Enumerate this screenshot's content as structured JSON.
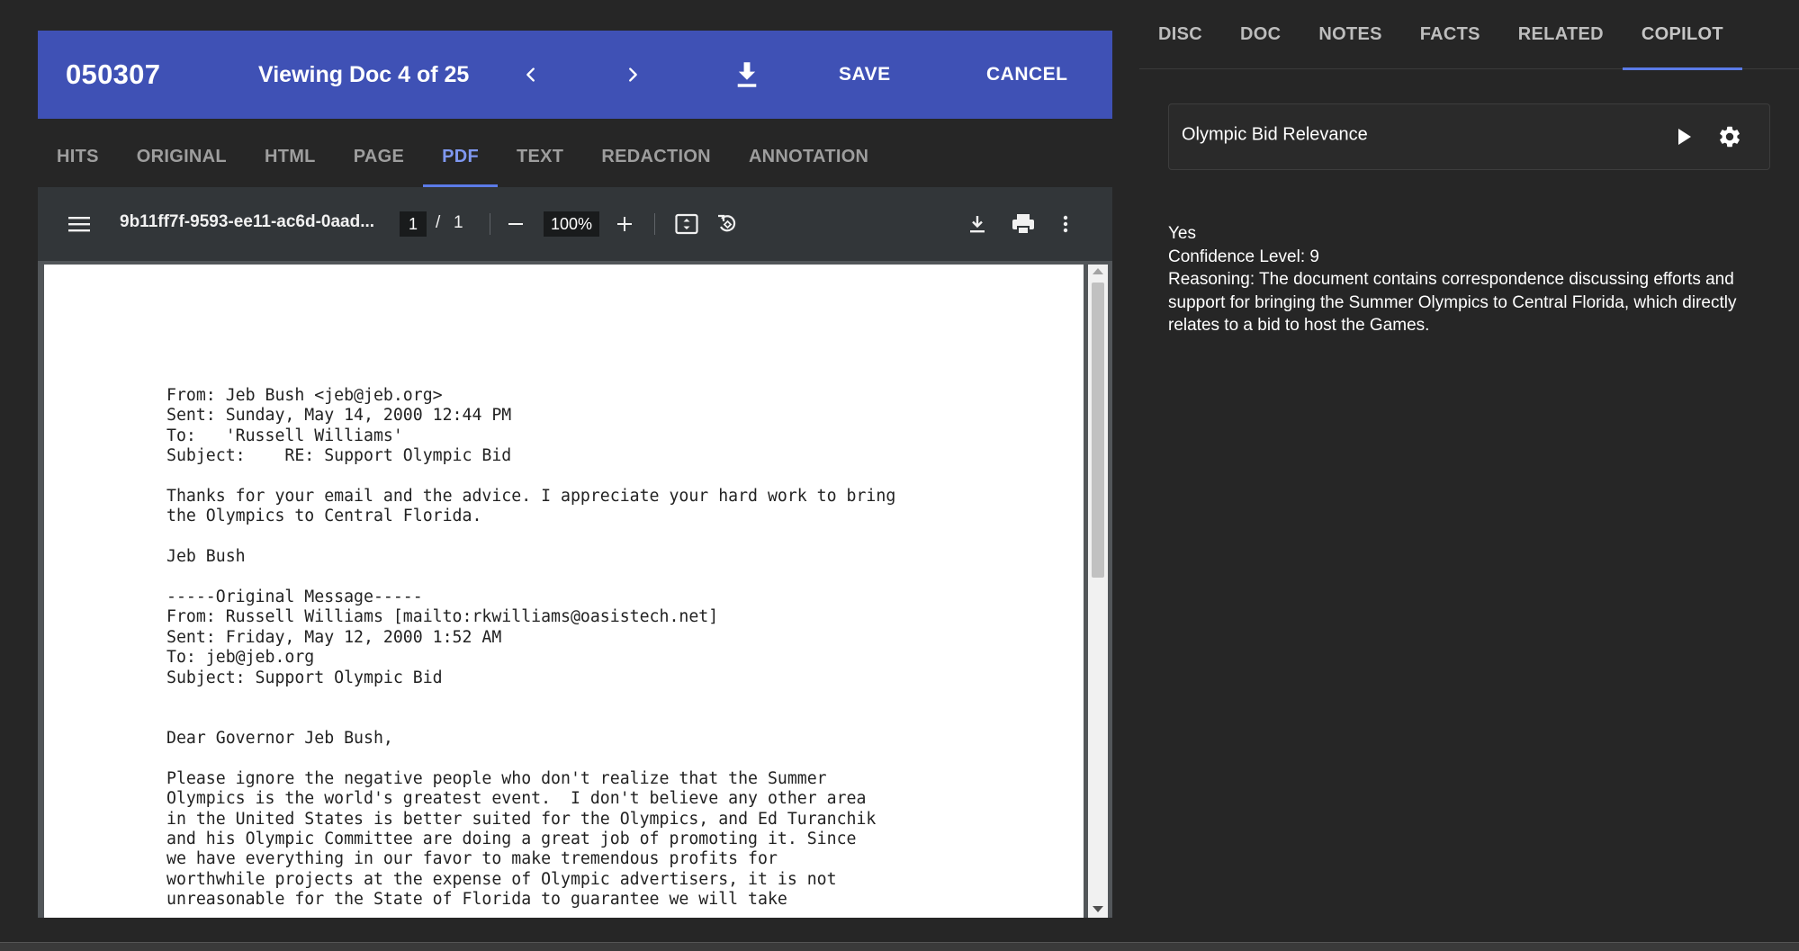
{
  "header": {
    "doc_id": "050307",
    "viewing": "Viewing Doc 4 of 25",
    "save_label": "SAVE",
    "cancel_label": "CANCEL",
    "bg_color": "#3f51b5"
  },
  "view_tabs": [
    {
      "label": "HITS"
    },
    {
      "label": "ORIGINAL"
    },
    {
      "label": "HTML"
    },
    {
      "label": "PAGE"
    },
    {
      "label": "PDF",
      "active": true
    },
    {
      "label": "TEXT"
    },
    {
      "label": "REDACTION"
    },
    {
      "label": "ANNOTATION"
    }
  ],
  "pdf": {
    "filename": "9b11ff7f-9593-ee11-ac6d-0aad...",
    "page_current": "1",
    "page_separator": "/",
    "page_total": "1",
    "zoom": "100%",
    "content": "From: Jeb Bush <jeb@jeb.org>\nSent: Sunday, May 14, 2000 12:44 PM\nTo:   'Russell Williams'\nSubject:    RE: Support Olympic Bid\n\nThanks for your email and the advice. I appreciate your hard work to bring\nthe Olympics to Central Florida.\n\nJeb Bush\n\n-----Original Message-----\nFrom: Russell Williams [mailto:rkwilliams@oasistech.net]\nSent: Friday, May 12, 2000 1:52 AM\nTo: jeb@jeb.org\nSubject: Support Olympic Bid\n\n\nDear Governor Jeb Bush,\n\nPlease ignore the negative people who don't realize that the Summer\nOlympics is the world's greatest event.  I don't believe any other area\nin the United States is better suited for the Olympics, and Ed Turanchik\nand his Olympic Committee are doing a great job of promoting it. Since\nwe have everything in our favor to make tremendous profits for\nworthwhile projects at the expense of Olympic advertisers, it is not\nunreasonable for the State of Florida to guarantee we will take"
  },
  "side_tabs": [
    {
      "label": "DISC"
    },
    {
      "label": "DOC"
    },
    {
      "label": "NOTES"
    },
    {
      "label": "FACTS"
    },
    {
      "label": "RELATED"
    },
    {
      "label": "COPILOT",
      "active": true
    }
  ],
  "copilot": {
    "prompt": "Olympic Bid Relevance",
    "answer": "Yes",
    "confidence": "Confidence Level: 9",
    "reasoning": "Reasoning: The document contains correspondence discussing efforts and support for bringing the Summer Olympics to Central Florida, which directly relates to a bid to host the Games."
  },
  "icons": {
    "prev": "chevron-left-icon",
    "next": "chevron-right-icon",
    "download": "download-icon",
    "menu": "menu-icon",
    "zoom_out": "minus-icon",
    "zoom_in": "plus-icon",
    "fit": "fit-page-icon",
    "rotate": "rotate-icon",
    "print": "print-icon",
    "more": "more-vert-icon",
    "run": "play-icon",
    "settings": "gear-icon"
  }
}
